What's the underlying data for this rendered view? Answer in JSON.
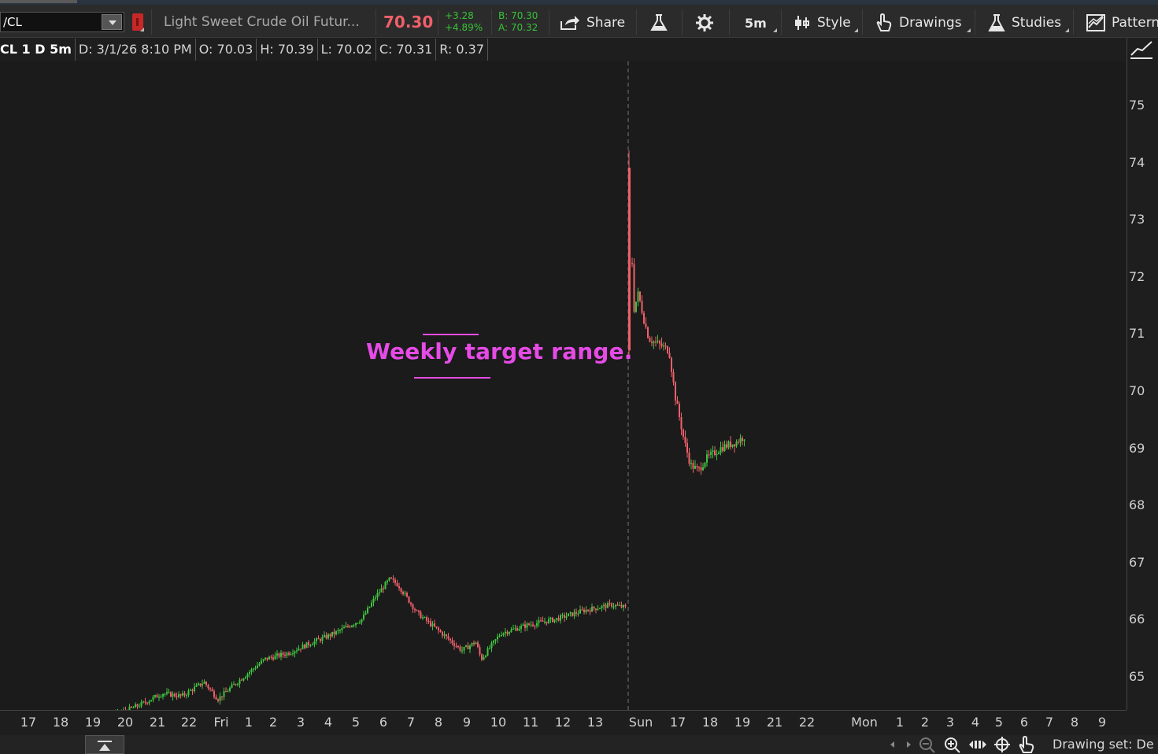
{
  "toolbar": {
    "symbol": "/CL",
    "description": "Light Sweet Crude Oil Futur...",
    "last_price": "70.30",
    "change": "+3.28",
    "change_pct": "+4.89%",
    "bid": "B: 70.30",
    "ask": "A: 70.32",
    "share_label": "Share",
    "timeframe_label": "5m",
    "style_label": "Style",
    "drawings_label": "Drawings",
    "studies_label": "Studies",
    "patterns_label": "Pattern"
  },
  "infobar": {
    "title": "CL 1 D 5m",
    "date": "D: 3/1/26 8:10 PM",
    "open": "O: 70.03",
    "high": "H: 70.39",
    "low": "L: 70.02",
    "close": "C: 70.31",
    "range": "R: 0.37"
  },
  "annotation": {
    "text": "Weekly target range."
  },
  "footer": {
    "drawing_set": "Drawing set: De"
  },
  "colors": {
    "up": "#3fc43f",
    "down": "#f0606a",
    "annotation": "#e64be6",
    "background": "#1b1b1b"
  },
  "icons": [
    "share-icon",
    "flask-icon",
    "gear-icon",
    "candle-style-icon",
    "hand-drawing-icon",
    "studies-flask-icon",
    "pattern-icon",
    "zoom-out-icon",
    "zoom-in-icon",
    "pan-icon",
    "crosshair-icon",
    "hand-icon"
  ],
  "chart_data": {
    "type": "candlestick",
    "symbol": "/CL",
    "interval": "5m",
    "y_ticks": [
      75,
      74,
      73,
      72,
      71,
      70,
      69,
      68,
      67,
      66,
      65
    ],
    "x_ticks": [
      "17",
      "18",
      "19",
      "20",
      "21",
      "22",
      "Fri",
      "1",
      "2",
      "3",
      "4",
      "5",
      "6",
      "7",
      "8",
      "9",
      "10",
      "11",
      "12",
      "13",
      "Sun",
      "17",
      "18",
      "19",
      "21",
      "22",
      "Mon",
      "1",
      "2",
      "3",
      "4",
      "5",
      "6",
      "7",
      "8",
      "9"
    ],
    "session_break_label": "Sun",
    "series": [
      {
        "segment": "friday-session",
        "path": [
          [
            17,
            65.3
          ],
          [
            17.8,
            65.25
          ],
          [
            18,
            64.95
          ],
          [
            19,
            65.05
          ],
          [
            20,
            65.2
          ],
          [
            21,
            65.4
          ],
          [
            22,
            65.6
          ],
          [
            22.8,
            65.8
          ],
          [
            23.5,
            65.75
          ],
          [
            24.3,
            66.0
          ],
          [
            24.8,
            65.7
          ],
          [
            25.5,
            66.0
          ],
          [
            26.5,
            66.4
          ],
          [
            27.3,
            66.5
          ],
          [
            28,
            66.65
          ],
          [
            29,
            66.85
          ],
          [
            30,
            67.1
          ],
          [
            30.5,
            67.5
          ],
          [
            31,
            67.8
          ],
          [
            31.3,
            67.7
          ],
          [
            32,
            67.2
          ],
          [
            32.5,
            67.0
          ],
          [
            33,
            66.8
          ],
          [
            33.6,
            66.55
          ],
          [
            34.1,
            66.7
          ],
          [
            34.3,
            66.4
          ],
          [
            35,
            66.85
          ],
          [
            36,
            67.0
          ],
          [
            37,
            67.1
          ],
          [
            38,
            67.25
          ],
          [
            39,
            67.35
          ],
          [
            39.5,
            67.3
          ]
        ]
      },
      {
        "segment": "sunday-session",
        "path": [
          [
            0,
            75.0
          ],
          [
            0.3,
            72.5
          ],
          [
            0.6,
            72.8
          ],
          [
            1,
            72.3
          ],
          [
            1.3,
            72.0
          ],
          [
            2,
            71.9
          ],
          [
            2.6,
            71.8
          ],
          [
            3.0,
            71.0
          ],
          [
            3.6,
            70.2
          ],
          [
            4.0,
            69.8
          ],
          [
            4.5,
            69.7
          ],
          [
            5,
            69.9
          ],
          [
            6,
            70.1
          ],
          [
            7,
            70.2
          ],
          [
            7.5,
            70.3
          ]
        ]
      }
    ]
  }
}
